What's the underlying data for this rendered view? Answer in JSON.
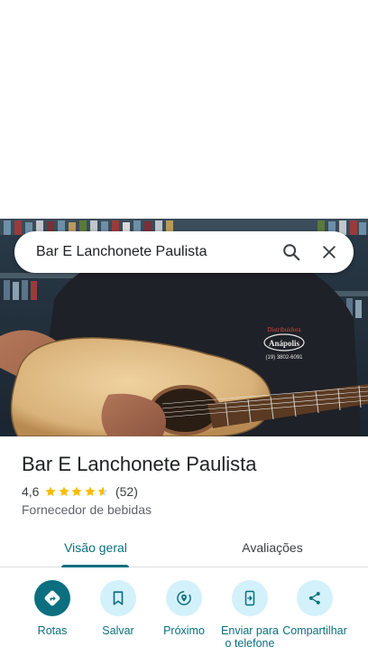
{
  "search": {
    "query": "Bar E Lanchonete Paulista",
    "search_icon": "search-icon",
    "close_icon": "close-icon"
  },
  "hero": {
    "shirt_brand_line1": "Distribuidora",
    "shirt_brand_line2": "Anápolis",
    "shirt_phone": "(19) 3802-6091"
  },
  "place": {
    "title": "Bar E Lanchonete Paulista",
    "rating": "4,6",
    "stars": 4.6,
    "review_count": "(52)",
    "category": "Fornecedor de bebidas"
  },
  "tabs": [
    {
      "label": "Visão geral",
      "selected": true
    },
    {
      "label": "Avaliações",
      "selected": false
    }
  ],
  "actions": [
    {
      "label": "Rotas",
      "icon": "directions-icon"
    },
    {
      "label": "Salvar",
      "icon": "bookmark-icon"
    },
    {
      "label": "Próximo",
      "icon": "nearby-icon"
    },
    {
      "label": "Enviar para o telefone",
      "icon": "send-to-phone-icon"
    },
    {
      "label": "Compartilhar",
      "icon": "share-icon"
    }
  ],
  "colors": {
    "accent": "#0b6f7f",
    "action_bg": "#d3f1fa",
    "star": "#fbbc04"
  }
}
